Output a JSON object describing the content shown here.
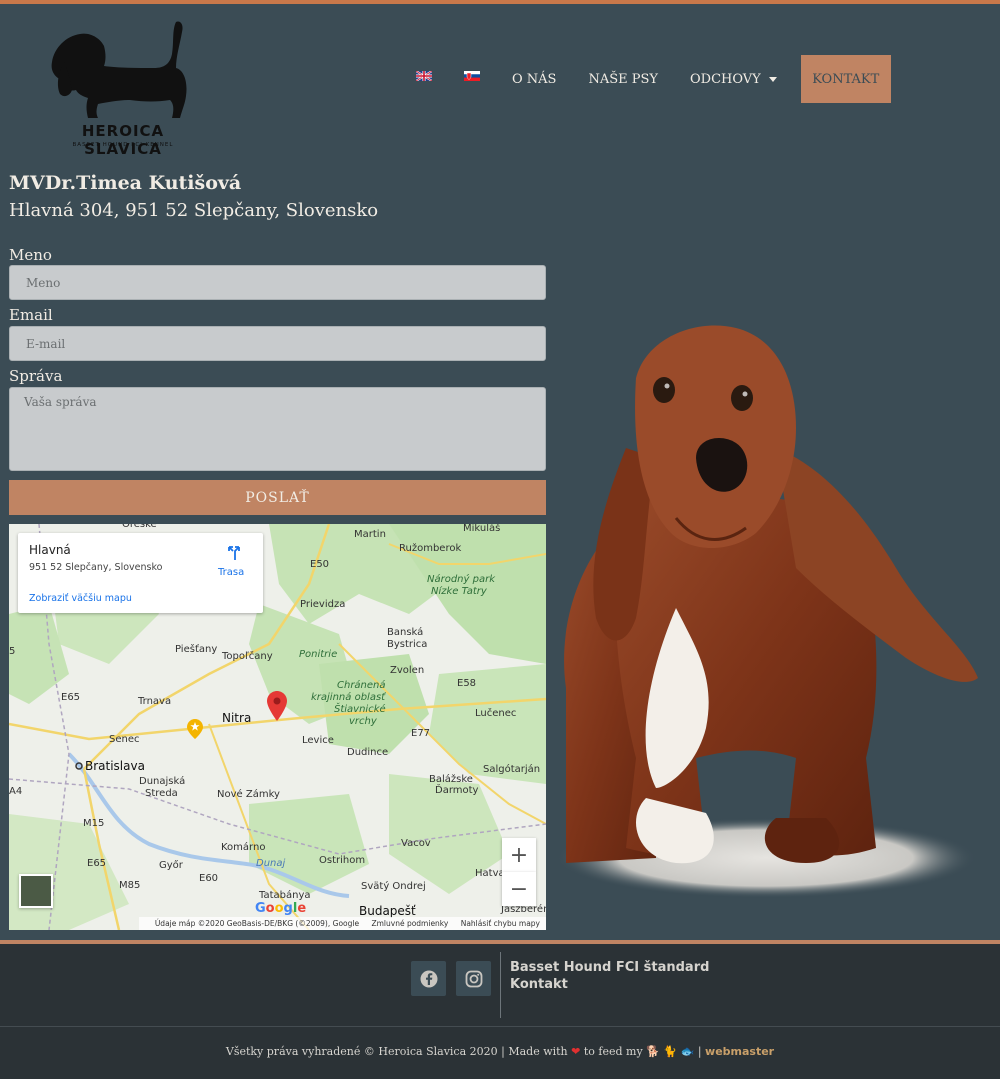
{
  "brand": {
    "name": "HEROICA SLAVICA",
    "tagline": "BASSET HOUND FCI KENNEL",
    "accent": "#c08463",
    "background": "#3b4c55",
    "top_border": "#c9784a"
  },
  "nav": {
    "flags": [
      "uk-flag-icon",
      "slovak-flag-icon"
    ],
    "items": [
      {
        "label": "O NÁS"
      },
      {
        "label": "NAŠE PSY"
      },
      {
        "label": "ODCHOVY",
        "has_dropdown": true
      }
    ],
    "cta": "KONTAKT"
  },
  "contact": {
    "name": "MVDr.Timea Kutišová",
    "address": "Hlavná 304, 951 52 Slepčany, Slovensko"
  },
  "form": {
    "name_label": "Meno",
    "name_placeholder": "Meno",
    "email_label": "Email",
    "email_placeholder": "E-mail",
    "message_label": "Správa",
    "message_placeholder": "Vaša správa",
    "submit_label": "POSLAŤ"
  },
  "map": {
    "card_title": "Hlavná",
    "card_address": "951 52 Slepčany, Slovensko",
    "card_link": "Zobraziť väčšiu mapu",
    "directions_label": "Trasa",
    "zoom_in": "+",
    "zoom_out": "−",
    "google": "Google",
    "footer_data": "Údaje máp ©2020 GeoBasis-DE/BKG (©2009), Google",
    "footer_terms": "Zmluvné podmienky",
    "footer_report": "Nahlásiť chybu mapy",
    "places": {
      "martin": "Martin",
      "mikulas": "Mikuláš",
      "ruzomberok": "Ružomberok",
      "narodny_park": "Národný park",
      "nizke_tatry": "Nízke Tatry",
      "prievidza": "Prievidza",
      "banska": "Banská",
      "bystrica": "Bystrica",
      "piestany": "Piešťany",
      "topolcany": "Topoľčany",
      "ponitrie": "Ponitrie",
      "zvolen": "Zvolen",
      "chranena": "Chránená",
      "krajinna_oblast": "krajinná oblasť",
      "stiavnicke": "Štiavnické",
      "vrchy": "vrchy",
      "trnava": "Trnava",
      "nitra": "Nitra",
      "lucenec": "Lučenec",
      "senec": "Senec",
      "levice": "Levice",
      "dudince": "Dudince",
      "bratislava": "Bratislava",
      "dunajska": "Dunajská",
      "streda": "Streda",
      "balazske": "Balážske",
      "darmoty": "Ďarmoty",
      "salgotarjan": "Salgótarján",
      "nove_zamky": "Nové Zámky",
      "komarno": "Komárno",
      "vacov": "Vacov",
      "dunaj": "Dunaj",
      "ostrihom": "Ostrihom",
      "gyor": "Győr",
      "tatabanya": "Tatabánya",
      "svaty_ondrej": "Svätý Ondrej",
      "budapest": "Budapešť",
      "hatva": "Hatva",
      "jaszbereny": "Jászberény",
      "e50": "E50",
      "e65": "E65",
      "e58": "E58",
      "e77": "E77",
      "e60": "E60",
      "a4": "A4",
      "m15": "M15",
      "m85": "M85"
    }
  },
  "footer": {
    "links": [
      "Basset Hound FCI štandard",
      "Kontakt"
    ],
    "social": [
      "facebook-icon",
      "instagram-icon"
    ],
    "copyright_prefix": "Všetky práva vyhradené © Heroica Slavica 2020 | Made with",
    "copyright_middle": "to feed my",
    "copyright_sep": "|",
    "webmaster": "webmaster"
  }
}
